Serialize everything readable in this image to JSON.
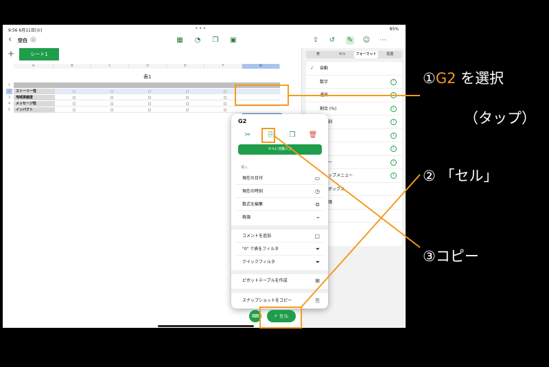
{
  "status_bar": {
    "time": "9:56",
    "date": "6月11日(火)",
    "dots": "•••",
    "battery": "85%"
  },
  "toolbar": {
    "title": "空白",
    "title_caret": "⌄",
    "back": "‹"
  },
  "sheet_tabs": {
    "add": "+",
    "active": "シート1"
  },
  "columns": [
    "A",
    "B",
    "C",
    "D",
    "E",
    "F",
    "G"
  ],
  "rows": [
    "1",
    "2",
    "3",
    "4",
    "5"
  ],
  "table": {
    "title": "表1",
    "row_labels": [
      "ストーリー性",
      "地域貢献度",
      "メッセージ性",
      "インパクト"
    ],
    "selected_value": "0"
  },
  "inspector": {
    "tabs": [
      "表",
      "セル",
      "フォーマット",
      "配置"
    ],
    "formats": [
      "自動",
      "数字",
      "通貨",
      "割合 (%)",
      "と時刻",
      "",
      "イダ",
      "ッパー",
      "プアップメニュー",
      "ックボックス",
      "の評価",
      "スト"
    ]
  },
  "popup": {
    "title": "G2",
    "autofill": "セルに自動入力",
    "section_label": "挿入",
    "insert_items": [
      "現在の日付",
      "現在の時刻",
      "数式を編集",
      "株価"
    ],
    "filter_items": [
      "コメントを追加",
      "\"0\" で表をフィルタ",
      "クイックフィルタ"
    ],
    "pivot": "ピボットテーブルを作成",
    "snapshot": "スナップショットをコピー"
  },
  "bottom": {
    "cell_button": "セル"
  },
  "annotations": {
    "step1_prefix": "①",
    "step1_cell": "G2",
    "step1_suffix": " を選択",
    "step1_line2": "（タップ）",
    "step2": "② 「セル」",
    "step3": "③コピー"
  },
  "colors": {
    "accent": "#1f9d4a",
    "highlight": "#f39a1e",
    "selection": "#3a6fd8"
  }
}
